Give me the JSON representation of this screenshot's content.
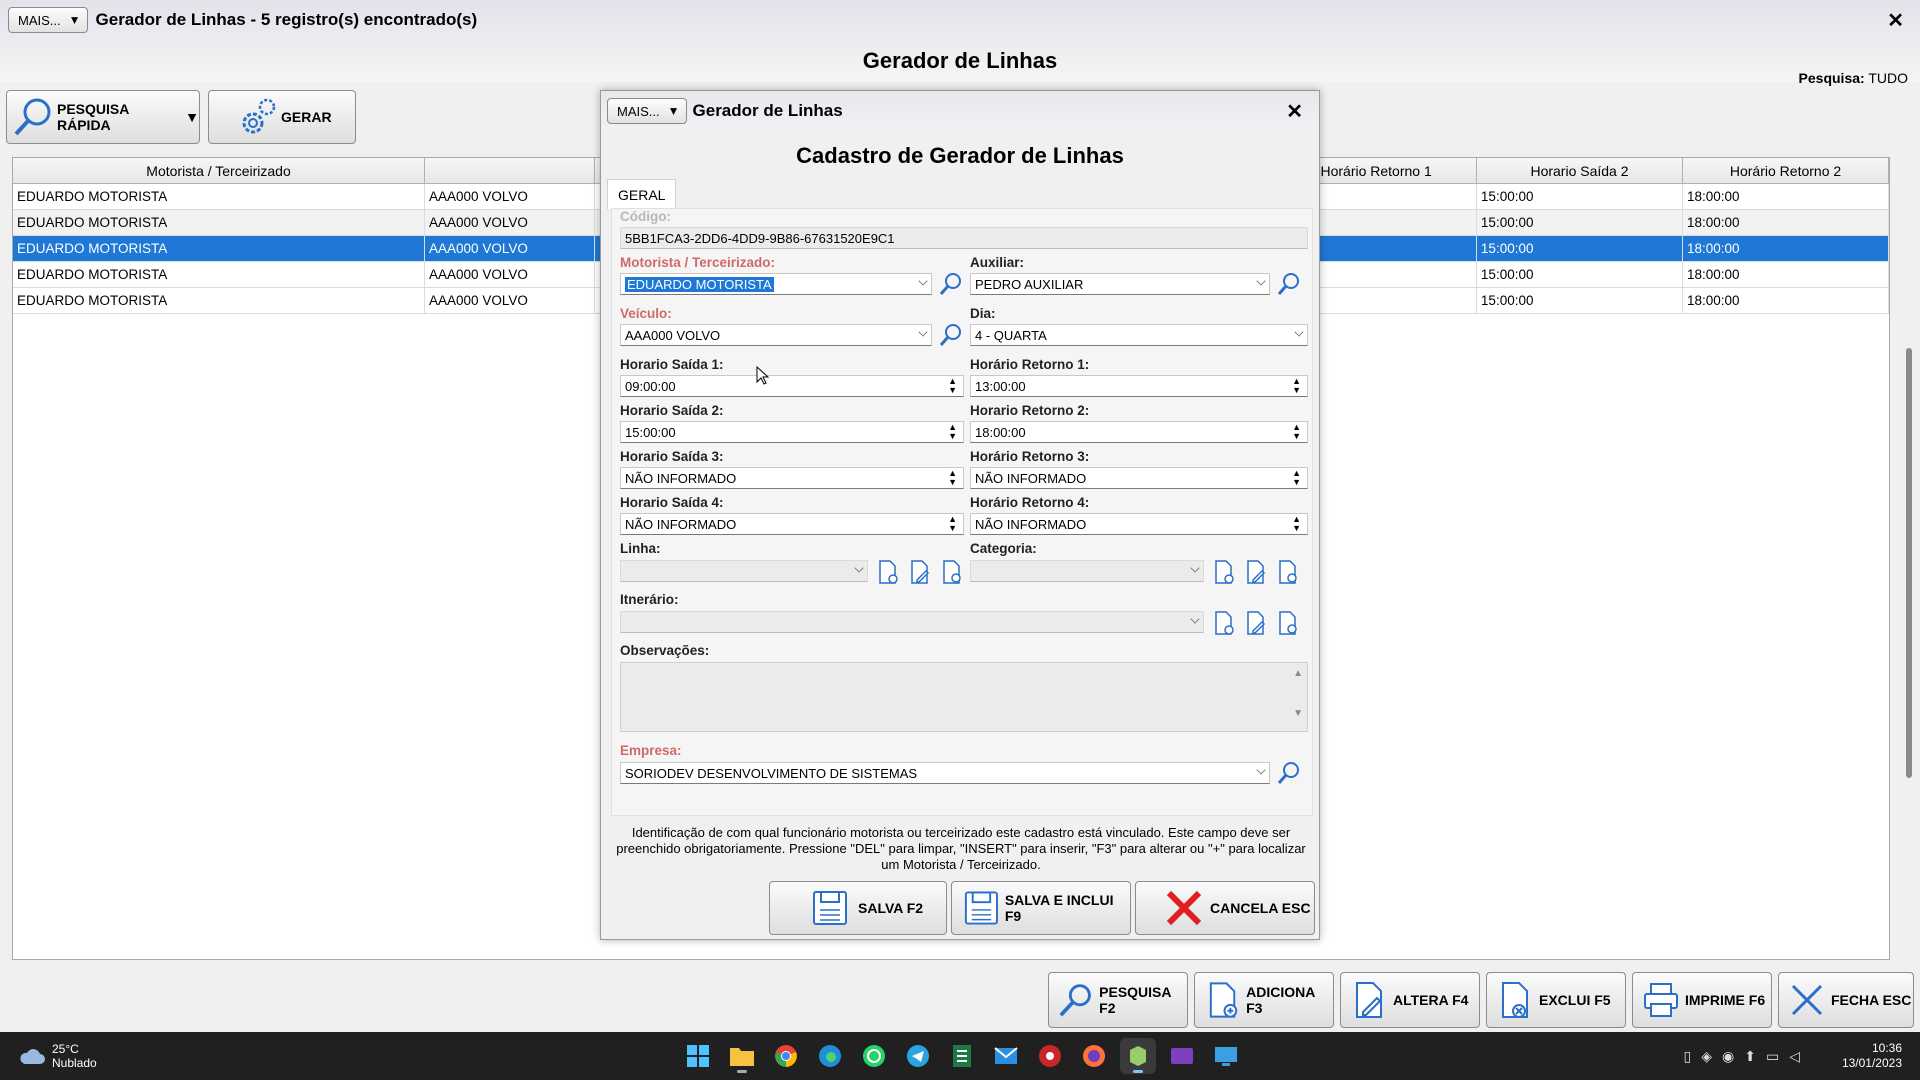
{
  "window": {
    "mais_label": "MAIS...",
    "title": "Gerador de Linhas - 5 registro(s) encontrado(s)",
    "close_glyph": "✕",
    "header": "Gerador de Linhas",
    "search_scope_label": "Pesquisa:",
    "search_scope_value": "TUDO"
  },
  "toolbar": {
    "quick_search_label": "PESQUISA RÁPIDA",
    "generate_label": "GERAR"
  },
  "grid": {
    "columns": [
      "Motorista / Terceirizado",
      "",
      "Horário Retorno 1",
      "Horario Saída 2",
      "Horário Retorno 2"
    ],
    "rows": [
      [
        "EDUARDO MOTORISTA",
        "AAA000 VOLVO",
        "",
        "15:00:00",
        "18:00:00"
      ],
      [
        "EDUARDO MOTORISTA",
        "AAA000 VOLVO",
        "",
        "15:00:00",
        "18:00:00"
      ],
      [
        "EDUARDO MOTORISTA",
        "AAA000 VOLVO",
        "",
        "15:00:00",
        "18:00:00"
      ],
      [
        "EDUARDO MOTORISTA",
        "AAA000 VOLVO",
        "",
        "15:00:00",
        "18:00:00"
      ],
      [
        "EDUARDO MOTORISTA",
        "AAA000 VOLVO",
        "",
        "15:00:00",
        "18:00:00"
      ]
    ],
    "selected_row": 2
  },
  "bottom_buttons": {
    "search": "PESQUISA F2",
    "add": "ADICIONA F3",
    "edit": "ALTERA F4",
    "delete": "EXCLUI F5",
    "print": "IMPRIME F6",
    "close": "FECHA ESC"
  },
  "dialog": {
    "mais_label": "MAIS...",
    "title": "Gerador de Linhas",
    "heading": "Cadastro de Gerador de Linhas",
    "tab": "GERAL",
    "code_label": "Código:",
    "code_value": "5BB1FCA3-2DD6-4DD9-9B86-67631520E9C1",
    "driver_label": "Motorista / Terceirizado:",
    "driver_value": "EDUARDO MOTORISTA",
    "assistant_label": "Auxiliar:",
    "assistant_value": "PEDRO AUXILIAR",
    "vehicle_label": "Veículo:",
    "vehicle_value": "AAA000 VOLVO",
    "day_label": "Dia:",
    "day_value": "4 - QUARTA",
    "dep1_label": "Horario Saída 1:",
    "dep1_value": "09:00:00",
    "ret1_label": "Horário Retorno 1:",
    "ret1_value": "13:00:00",
    "dep2_label": "Horario Saída 2:",
    "dep2_value": "15:00:00",
    "ret2_label": "Horario Retorno 2:",
    "ret2_value": "18:00:00",
    "dep3_label": "Horario Saída 3:",
    "dep3_value": "NÃO INFORMADO",
    "ret3_label": "Horário Retorno 3:",
    "ret3_value": "NÃO INFORMADO",
    "dep4_label": "Horario Saída 4:",
    "dep4_value": "NÃO INFORMADO",
    "ret4_label": "Horário Retorno 4:",
    "ret4_value": "NÃO INFORMADO",
    "line_label": "Linha:",
    "line_value": "",
    "category_label": "Categoria:",
    "category_value": "",
    "itinerary_label": "Itnerário:",
    "itinerary_value": "",
    "notes_label": "Observações:",
    "company_label": "Empresa:",
    "company_value": "SORIODEV DESENVOLVIMENTO DE SISTEMAS",
    "hint": "Identificação de com qual funcionário motorista ou terceirizado este cadastro está vinculado. Este campo deve ser preenchido obrigatoriamente. Pressione \"DEL\" para limpar, \"INSERT\" para inserir, \"F3\" para alterar ou \"+\" para localizar um Motorista / Terceirizado.",
    "save_label": "SALVA F2",
    "save_new_label": "SALVA E INCLUI F9",
    "cancel_label": "CANCELA ESC"
  },
  "taskbar": {
    "temperature": "25°C",
    "weather": "Nublado",
    "time": "10:36",
    "date": "13/01/2023"
  },
  "colors": {
    "selection": "#1f78d6",
    "required_label": "#d06a6a",
    "cancel_red": "#e02020"
  }
}
